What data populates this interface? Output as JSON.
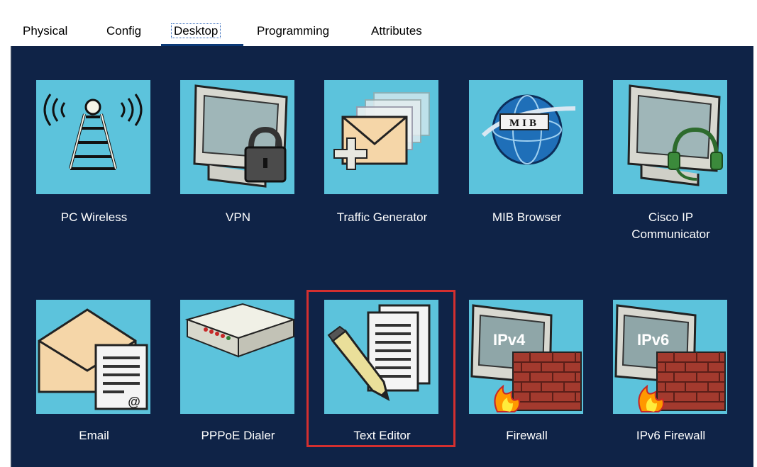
{
  "tabs": [
    {
      "label": "Physical"
    },
    {
      "label": "Config"
    },
    {
      "label": "Desktop"
    },
    {
      "label": "Programming"
    },
    {
      "label": "Attributes"
    }
  ],
  "active_tab": "Desktop",
  "apps": [
    {
      "label": "PC Wireless",
      "icon": "radio-tower-icon"
    },
    {
      "label": "VPN",
      "icon": "monitor-lock-icon"
    },
    {
      "label": "Traffic Generator",
      "icon": "envelopes-stack-icon"
    },
    {
      "label": "MIB Browser",
      "icon": "mib-globe-icon"
    },
    {
      "label": "Cisco IP Communicator",
      "label_line1": "Cisco IP",
      "label_line2": "Communicator",
      "icon": "monitor-headset-icon"
    },
    {
      "label": "Email",
      "icon": "envelope-document-icon"
    },
    {
      "label": "PPPoE Dialer",
      "icon": "modem-icon"
    },
    {
      "label": "Text Editor",
      "icon": "pencil-document-icon"
    },
    {
      "label": "Firewall",
      "icon": "ipv4-firewall-icon",
      "badge": "IPv4"
    },
    {
      "label": "IPv6 Firewall",
      "icon": "ipv6-firewall-icon",
      "badge": "IPv6"
    }
  ],
  "mib_text": "MIB",
  "email_at": "@",
  "colors": {
    "panel_bg": "#0f2347",
    "tile_bg": "#5cc3dc",
    "highlight": "#d32f2f",
    "tab_underline": "#0b3a78"
  }
}
